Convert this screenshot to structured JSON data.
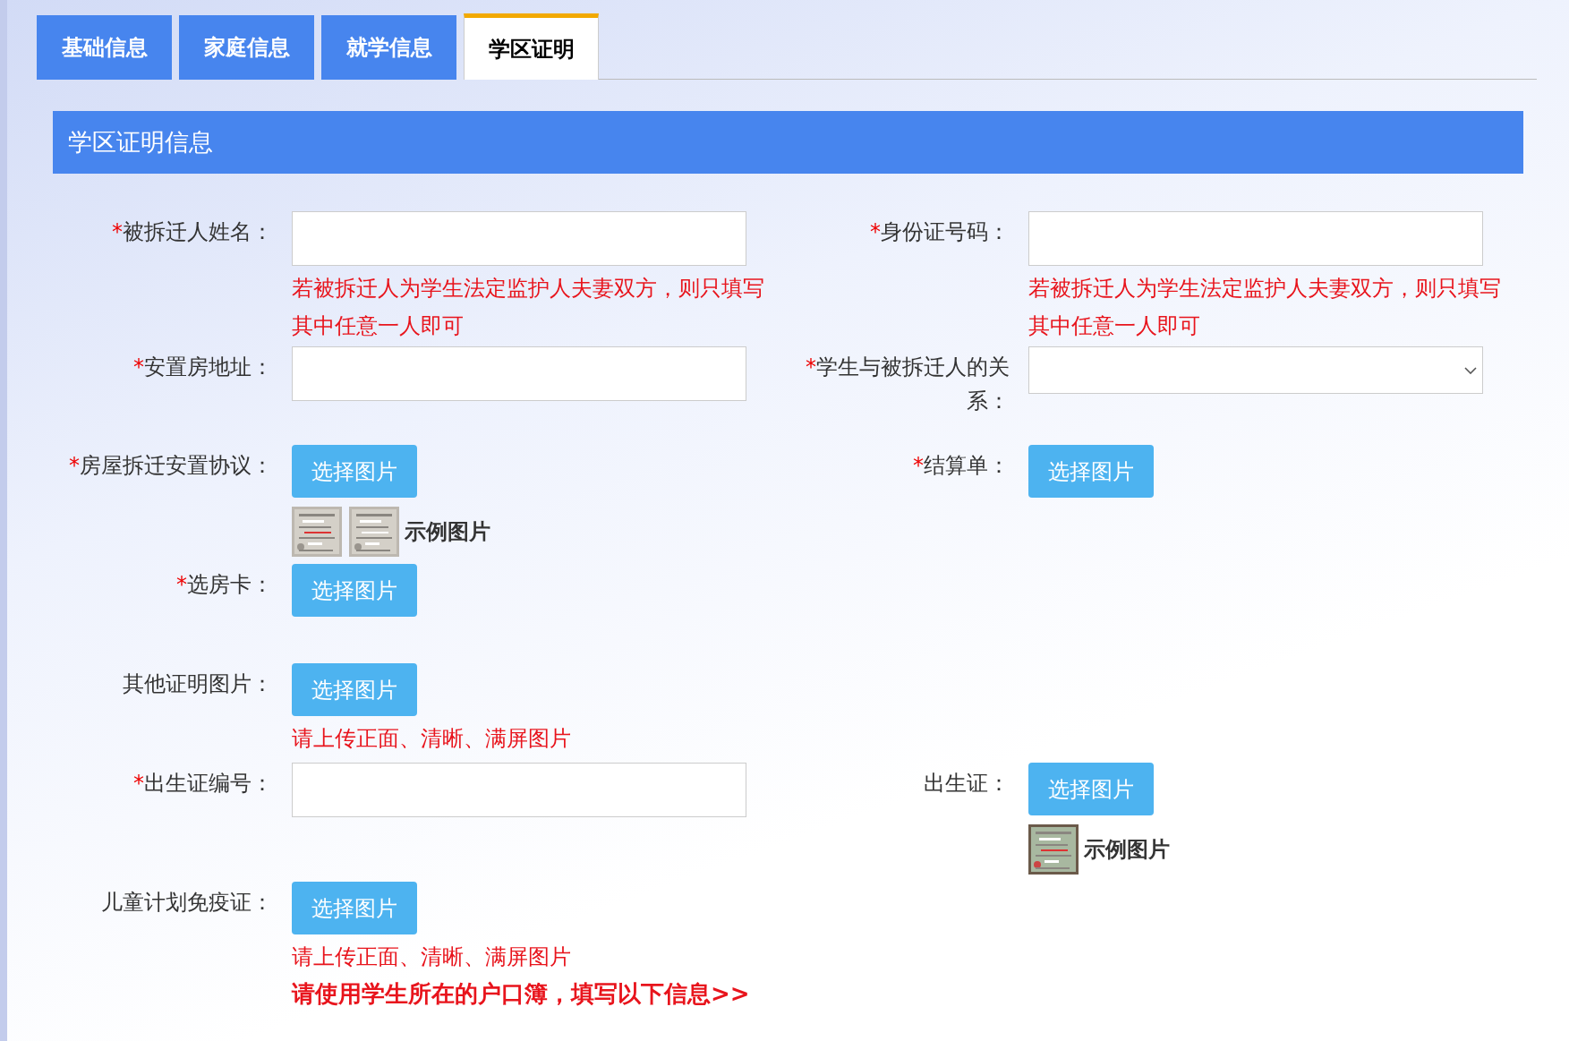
{
  "tabs": [
    {
      "label": "基础信息",
      "selected": false
    },
    {
      "label": "家庭信息",
      "selected": false
    },
    {
      "label": "就学信息",
      "selected": false
    },
    {
      "label": "学区证明",
      "selected": true
    }
  ],
  "section": {
    "title": "学区证明信息"
  },
  "rows": [
    {
      "left": {
        "kind": "text",
        "mark": "*",
        "label": "被拆迁人姓名：",
        "hints": [
          {
            "kind": "note",
            "text": "若被拆迁人为学生法定监护人夫妻双方，则只填写其中任意一人即可"
          }
        ]
      },
      "right": {
        "kind": "text",
        "mark": "*",
        "label": "身份证号码：",
        "hints": [
          {
            "kind": "note",
            "text": "若被拆迁人为学生法定监护人夫妻双方，则只填写其中任意一人即可"
          }
        ]
      }
    },
    {
      "left": {
        "kind": "text",
        "mark": "*",
        "label": "安置房地址："
      },
      "right": {
        "kind": "select",
        "mark": "*",
        "label": "学生与被拆迁人的关系："
      }
    },
    {
      "left": {
        "kind": "upload",
        "mark": "*",
        "label": "房屋拆迁安置协议：",
        "button": "选择图片",
        "sample_label": "示例图片"
      },
      "right": {
        "kind": "upload",
        "mark": "*",
        "label": "结算单：",
        "button": "选择图片"
      }
    },
    {
      "left": {
        "kind": "upload",
        "mark": "*",
        "label": "选房卡：",
        "button": "选择图片"
      }
    },
    {
      "left": {
        "kind": "upload",
        "label": "其他证明图片：",
        "button": "选择图片",
        "hints": [
          {
            "kind": "note",
            "text": "请上传正面、清晰、满屏图片"
          }
        ]
      }
    },
    {
      "left": {
        "kind": "text",
        "mark": "*",
        "label": "出生证编号："
      },
      "right": {
        "kind": "upload",
        "label": "出生证：",
        "button": "选择图片",
        "sample_label": "示例图片"
      }
    },
    {
      "left": {
        "kind": "upload",
        "label": "儿童计划免疫证：",
        "button": "选择图片",
        "hints": [
          {
            "kind": "note",
            "text": "请上传正面、清晰、满屏图片"
          },
          {
            "kind": "notice",
            "text": "请使用学生所在的户口簿，填写以下信息>>"
          }
        ]
      }
    }
  ]
}
